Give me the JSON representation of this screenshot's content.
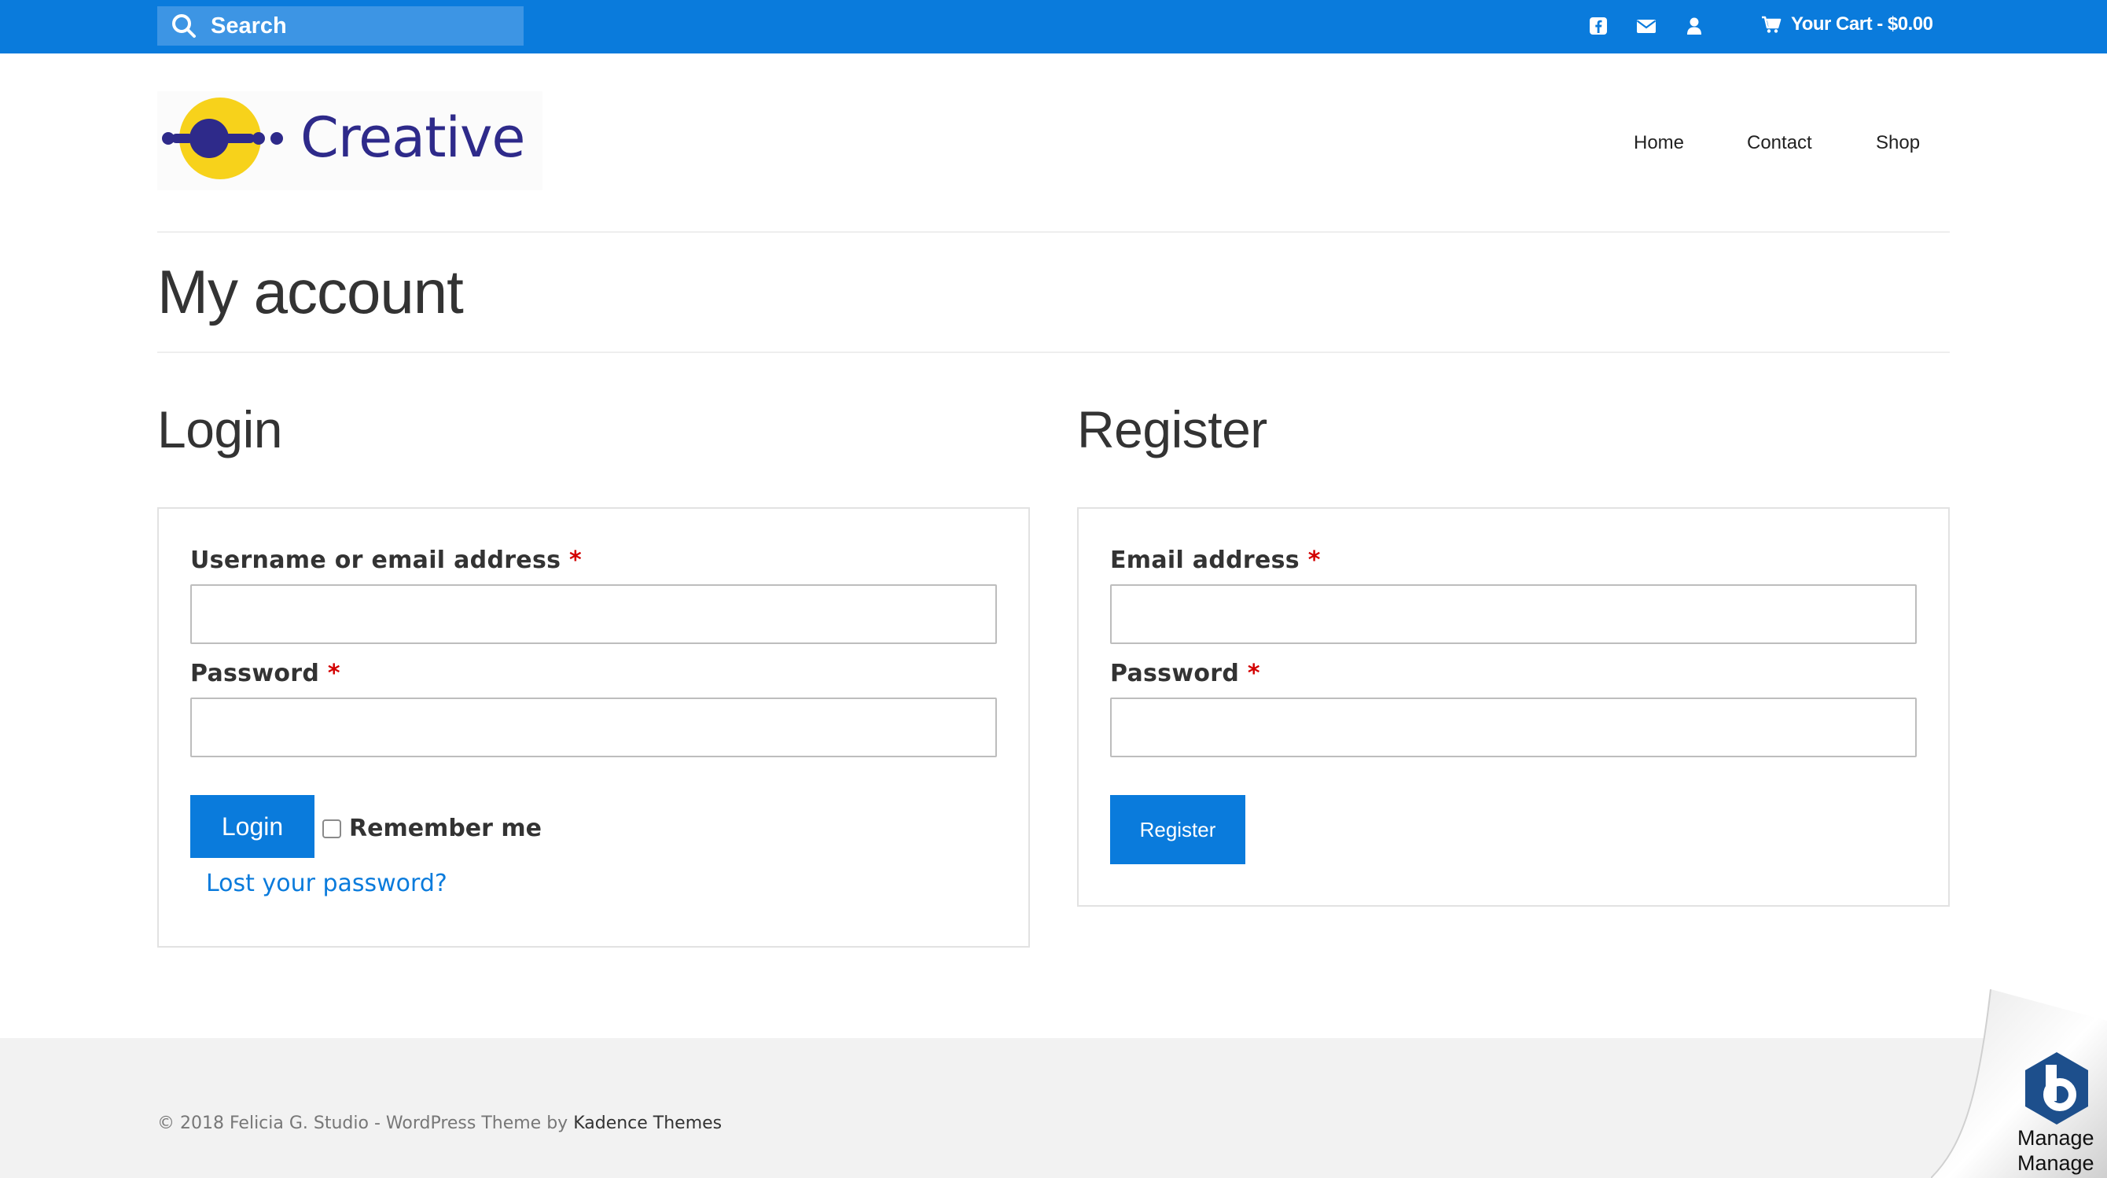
{
  "topbar": {
    "search_placeholder": "Search",
    "icons": [
      "facebook-icon",
      "mail-icon",
      "user-icon"
    ],
    "cart_label": "Your Cart - $0.00",
    "background": "#0a7bdc"
  },
  "header": {
    "logo_text": "Creative",
    "nav": [
      "Home",
      "Contact",
      "Shop"
    ]
  },
  "page": {
    "title": "My account"
  },
  "login": {
    "heading": "Login",
    "username_label": "Username or email address",
    "password_label": "Password",
    "required_mark": "*",
    "username_value": "",
    "password_value": "",
    "submit_label": "Login",
    "remember_label": "Remember me",
    "remember_checked": false,
    "lost_password": "Lost your password?"
  },
  "register": {
    "heading": "Register",
    "email_label": "Email address",
    "password_label": "Password",
    "required_mark": "*",
    "email_value": "",
    "password_value": "",
    "submit_label": "Register"
  },
  "footer": {
    "copyright": "© 2018 Felicia G. Studio - WordPress Theme by ",
    "theme_link": "Kadence Themes"
  },
  "manage_widget": {
    "label_1": "Manage",
    "label_2": "Manage"
  },
  "colors": {
    "accent": "#0a7bdc",
    "required": "#d30000",
    "logo_yellow": "#f7d21b",
    "logo_navy": "#2e2a8a"
  }
}
